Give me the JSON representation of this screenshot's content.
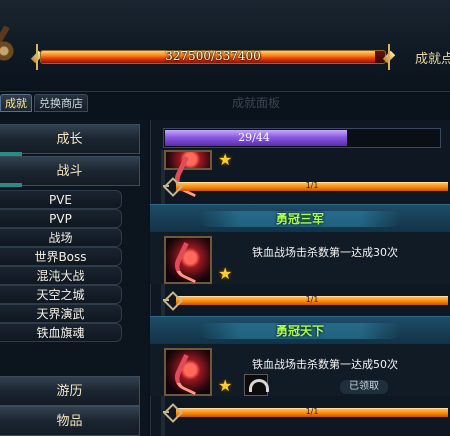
{
  "header": {
    "progress_text": "327500/337400",
    "progress_value": 0.9707,
    "achievement_label": "成就点"
  },
  "tabs": [
    {
      "label": "成就",
      "active": true
    },
    {
      "label": "兑换商店",
      "active": false
    }
  ],
  "faded_title": "成就面板",
  "categories": {
    "growth": "成长",
    "battle": "战斗",
    "sub_items": [
      "PVE",
      "PVP",
      "战场",
      "世界Boss",
      "混沌大战",
      "天空之城",
      "天界演武",
      "铁血旗魂"
    ],
    "travel": "游历",
    "items": "物品"
  },
  "top_progress": {
    "text": "29/44",
    "value": 0.659
  },
  "entries": [
    {
      "progress_text": "1/1"
    },
    {
      "title": "勇冠三军",
      "description": "铁血战场击杀数第一达成30次",
      "progress_text": "1/1"
    },
    {
      "title": "勇冠天下",
      "description": "铁血战场击杀数第一达成50次",
      "progress_text": "1/1",
      "status": "已领取"
    }
  ],
  "icons": {
    "emblem": "emblem-icon",
    "star": "star-icon",
    "medal": "medal-icon",
    "weapon": "weapon-icon"
  },
  "colors": {
    "title_green": "#a8ff4a",
    "progress_orange": "#ff8a0a",
    "progress_purple": "#8a5ae0",
    "star_gold": "#ffd02a"
  }
}
